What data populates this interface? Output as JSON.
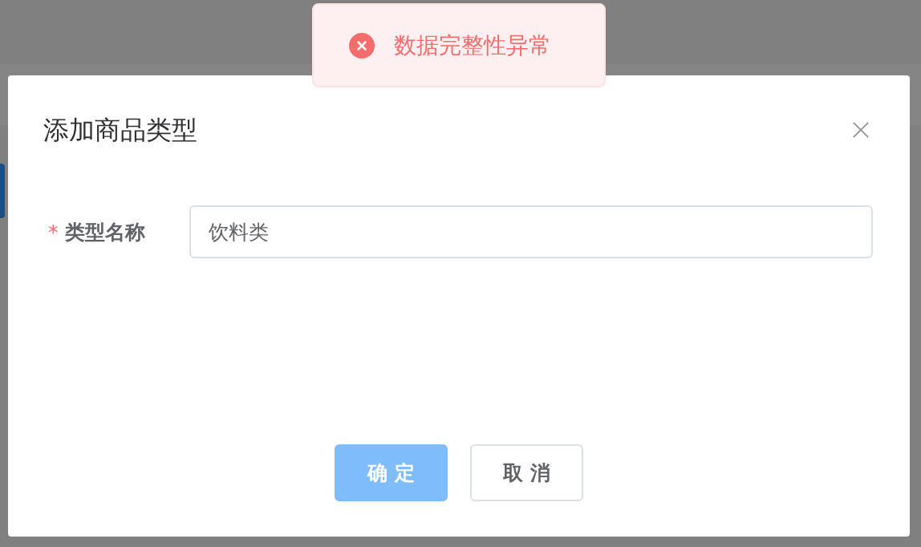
{
  "toast": {
    "kind": "error",
    "message": "数据完整性异常"
  },
  "dialog": {
    "title": "添加商品类型",
    "fields": [
      {
        "label": "类型名称",
        "required_mark": "*",
        "value": "饮料类"
      }
    ],
    "buttons": [
      {
        "label": "确 定",
        "kind": "primary",
        "disabled": true
      },
      {
        "label": "取 消",
        "kind": "default",
        "disabled": false
      }
    ]
  }
}
